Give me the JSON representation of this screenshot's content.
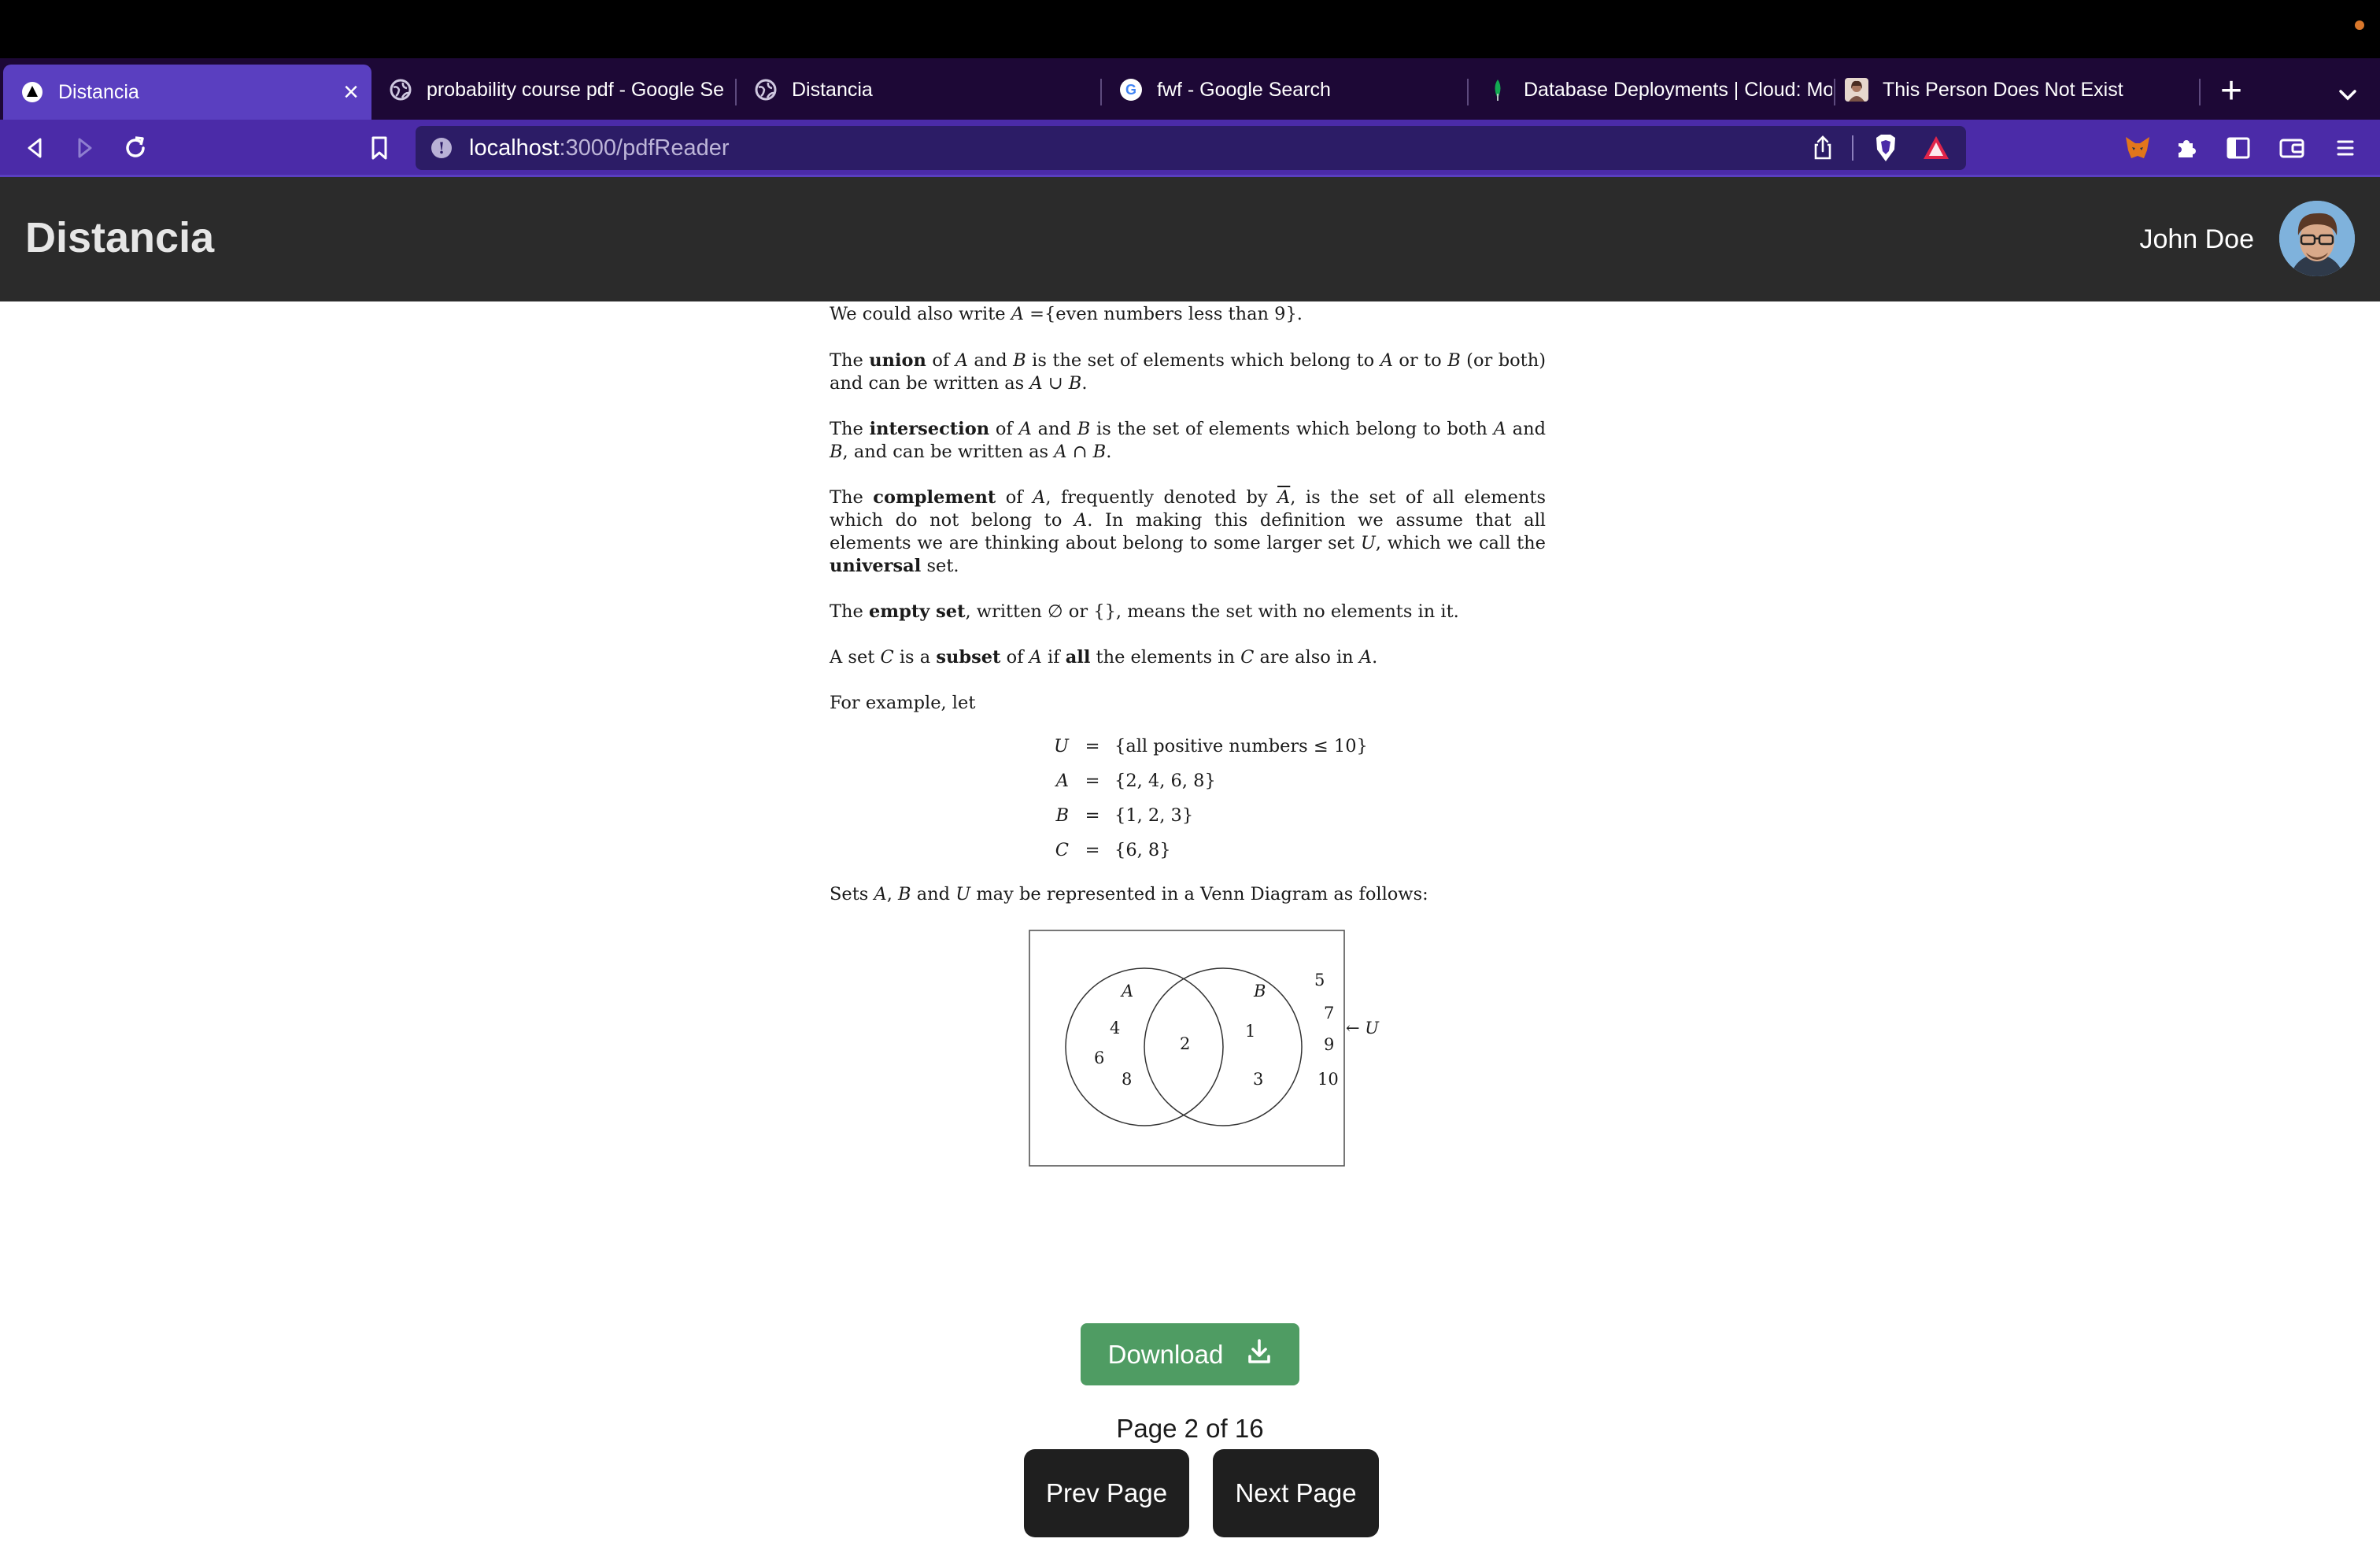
{
  "browser": {
    "tabs": [
      {
        "title": "Distancia",
        "favicon": "distancia-logo-icon",
        "active": true
      },
      {
        "title": "probability course pdf - Google Se",
        "favicon": "globe-icon"
      },
      {
        "title": "Distancia",
        "favicon": "globe-icon"
      },
      {
        "title": "fwf - Google Search",
        "favicon": "google-icon"
      },
      {
        "title": "Database Deployments | Cloud: Mo",
        "favicon": "mongodb-leaf-icon"
      },
      {
        "title": "This Person Does Not Exist",
        "favicon": "person-photo-icon"
      }
    ],
    "url": {
      "host": "localhost",
      "path": ":3000/pdfReader"
    },
    "accent": "#4b2ba8",
    "tabbar_bg": "#1d0836"
  },
  "app": {
    "brand": "Distancia",
    "user_name": "John Doe"
  },
  "pdf": {
    "p1": [
      "We could also write ",
      "A",
      " ={even numbers less than 9}."
    ],
    "union": [
      "The ",
      "union",
      " of ",
      "A",
      " and ",
      "B",
      " is the set of elements which belong to ",
      "A",
      " or to ",
      "B",
      " (or both) and can be written as ",
      "A",
      " ∪ ",
      "B",
      "."
    ],
    "intersection": [
      "The ",
      "intersection",
      " of ",
      "A",
      " and ",
      "B",
      " is the set of elements which belong to both ",
      "A",
      " and ",
      "B",
      ", and can be written as ",
      "A",
      " ∩ ",
      "B",
      "."
    ],
    "complement": [
      "The ",
      "complement",
      " of ",
      "A",
      ", frequently denoted by ",
      "A",
      ", is the set of all elements which do not belong to ",
      "A",
      ". In making this definition we assume that all elements we are thinking about belong to some larger set ",
      "U",
      ", which we call the ",
      "universal",
      " set."
    ],
    "empty": [
      "The ",
      "empty set",
      ", written ∅ or {}, means the set with no elements in it."
    ],
    "subset": [
      "A set ",
      "C",
      " is a ",
      "subset",
      " of ",
      "A",
      " if ",
      "all",
      " the elements in ",
      "C",
      " are also in ",
      "A",
      "."
    ],
    "example": "For example, let",
    "equations": [
      {
        "lhs": "U",
        "eq": "=",
        "rhs": "{all positive numbers ≤ 10}"
      },
      {
        "lhs": "A",
        "eq": "=",
        "rhs": "{2, 4, 6, 8}"
      },
      {
        "lhs": "B",
        "eq": "=",
        "rhs": "{1, 2, 3}"
      },
      {
        "lhs": "C",
        "eq": "=",
        "rhs": "{6, 8}"
      }
    ],
    "venn_intro": [
      "Sets ",
      "A",
      ", ",
      "B",
      " and ",
      "U",
      " may be represented in a Venn Diagram as follows:"
    ],
    "venn": {
      "label_a": "A",
      "label_b": "B",
      "label_u": "← U",
      "a_only": [
        "4",
        "6",
        "8"
      ],
      "both": [
        "2"
      ],
      "b_only": [
        "1",
        "3"
      ],
      "outside": [
        "5",
        "7",
        "9",
        "10"
      ]
    }
  },
  "controls": {
    "download_label": "Download",
    "page_indicator": "Page 2 of 16",
    "prev_label": "Prev Page",
    "next_label": "Next Page",
    "download_color": "#4f9c63",
    "nav_color": "#1f1f1f"
  }
}
